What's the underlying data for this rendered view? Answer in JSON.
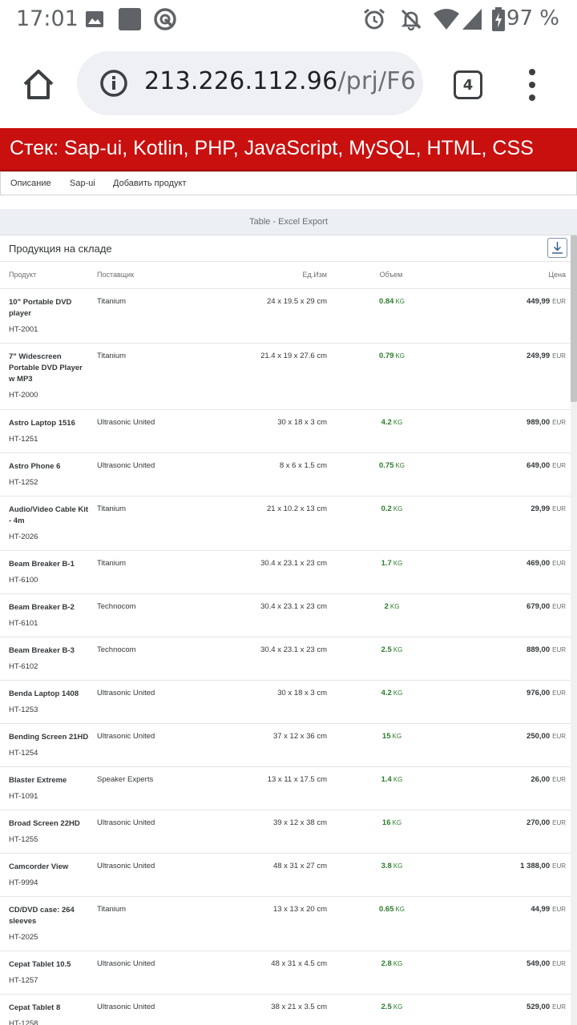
{
  "status_bar": {
    "time": "17:01",
    "battery_percent": "97 %",
    "icons": [
      "image-icon",
      "app-square-icon",
      "sync-icon",
      "alarm-icon",
      "notifications-off-icon",
      "wifi-icon",
      "signal-icon",
      "battery-icon"
    ]
  },
  "browser": {
    "url_host": "213.226.112.96",
    "url_path": "/prj/F6",
    "tab_count": "4"
  },
  "page": {
    "banner": "Стек: Sap-ui, Kotlin, PHP, JavaScript, MySQL, HTML, CSS",
    "nav": [
      "Описание",
      "Sap-ui",
      "Добавить продукт"
    ],
    "excel_title": "Table - Excel Export",
    "table_title": "Продукция на складе"
  },
  "table": {
    "columns": {
      "product": "Продукт",
      "supplier": "Поставщик",
      "dimensions": "Ед.Изм",
      "volume": "Объем",
      "price": "Цена"
    },
    "rows": [
      {
        "name": "10\" Portable DVD player",
        "id": "HT-2001",
        "supplier": "Titanium",
        "dims": "24 x 19.5 x 29 cm",
        "weight": "0.84",
        "weight_unit": "KG",
        "price": "449,99",
        "currency": "EUR"
      },
      {
        "name": "7\" Widescreen Portable DVD Player w MP3",
        "id": "HT-2000",
        "supplier": "Titanium",
        "dims": "21.4 x 19 x 27.6 cm",
        "weight": "0.79",
        "weight_unit": "KG",
        "price": "249,99",
        "currency": "EUR"
      },
      {
        "name": "Astro Laptop 1516",
        "id": "HT-1251",
        "supplier": "Ultrasonic United",
        "dims": "30 x 18 x 3 cm",
        "weight": "4.2",
        "weight_unit": "KG",
        "price": "989,00",
        "currency": "EUR"
      },
      {
        "name": "Astro Phone 6",
        "id": "HT-1252",
        "supplier": "Ultrasonic United",
        "dims": "8 x 6 x 1.5 cm",
        "weight": "0.75",
        "weight_unit": "KG",
        "price": "649,00",
        "currency": "EUR"
      },
      {
        "name": "Audio/Video Cable Kit - 4m",
        "id": "HT-2026",
        "supplier": "Titanium",
        "dims": "21 x 10.2 x 13 cm",
        "weight": "0.2",
        "weight_unit": "KG",
        "price": "29,99",
        "currency": "EUR"
      },
      {
        "name": "Beam Breaker B-1",
        "id": "HT-6100",
        "supplier": "Titanium",
        "dims": "30.4 x 23.1 x 23 cm",
        "weight": "1.7",
        "weight_unit": "KG",
        "price": "469,00",
        "currency": "EUR"
      },
      {
        "name": "Beam Breaker B-2",
        "id": "HT-6101",
        "supplier": "Technocom",
        "dims": "30.4 x 23.1 x 23 cm",
        "weight": "2",
        "weight_unit": "KG",
        "price": "679,00",
        "currency": "EUR"
      },
      {
        "name": "Beam Breaker B-3",
        "id": "HT-6102",
        "supplier": "Technocom",
        "dims": "30.4 x 23.1 x 23 cm",
        "weight": "2.5",
        "weight_unit": "KG",
        "price": "889,00",
        "currency": "EUR"
      },
      {
        "name": "Benda Laptop 1408",
        "id": "HT-1253",
        "supplier": "Ultrasonic United",
        "dims": "30 x 18 x 3 cm",
        "weight": "4.2",
        "weight_unit": "KG",
        "price": "976,00",
        "currency": "EUR"
      },
      {
        "name": "Bending Screen 21HD",
        "id": "HT-1254",
        "supplier": "Ultrasonic United",
        "dims": "37 x 12 x 36 cm",
        "weight": "15",
        "weight_unit": "KG",
        "price": "250,00",
        "currency": "EUR"
      },
      {
        "name": "Blaster Extreme",
        "id": "HT-1091",
        "supplier": "Speaker Experts",
        "dims": "13 x 11 x 17.5 cm",
        "weight": "1.4",
        "weight_unit": "KG",
        "price": "26,00",
        "currency": "EUR"
      },
      {
        "name": "Broad Screen 22HD",
        "id": "HT-1255",
        "supplier": "Ultrasonic United",
        "dims": "39 x 12 x 38 cm",
        "weight": "16",
        "weight_unit": "KG",
        "price": "270,00",
        "currency": "EUR"
      },
      {
        "name": "Camcorder View",
        "id": "HT-9994",
        "supplier": "Ultrasonic United",
        "dims": "48 x 31 x 27 cm",
        "weight": "3.8",
        "weight_unit": "KG",
        "price": "1 388,00",
        "currency": "EUR"
      },
      {
        "name": "CD/DVD case: 264 sleeves",
        "id": "HT-2025",
        "supplier": "Titanium",
        "dims": "13 x 13 x 20 cm",
        "weight": "0.65",
        "weight_unit": "KG",
        "price": "44,99",
        "currency": "EUR"
      },
      {
        "name": "Cepat Tablet 10.5",
        "id": "HT-1257",
        "supplier": "Ultrasonic United",
        "dims": "48 x 31 x 4.5 cm",
        "weight": "2.8",
        "weight_unit": "KG",
        "price": "549,00",
        "currency": "EUR"
      },
      {
        "name": "Cepat Tablet 8",
        "id": "HT-1258",
        "supplier": "Ultrasonic United",
        "dims": "38 x 21 x 3.5 cm",
        "weight": "2.5",
        "weight_unit": "KG",
        "price": "529,00",
        "currency": "EUR"
      }
    ]
  }
}
